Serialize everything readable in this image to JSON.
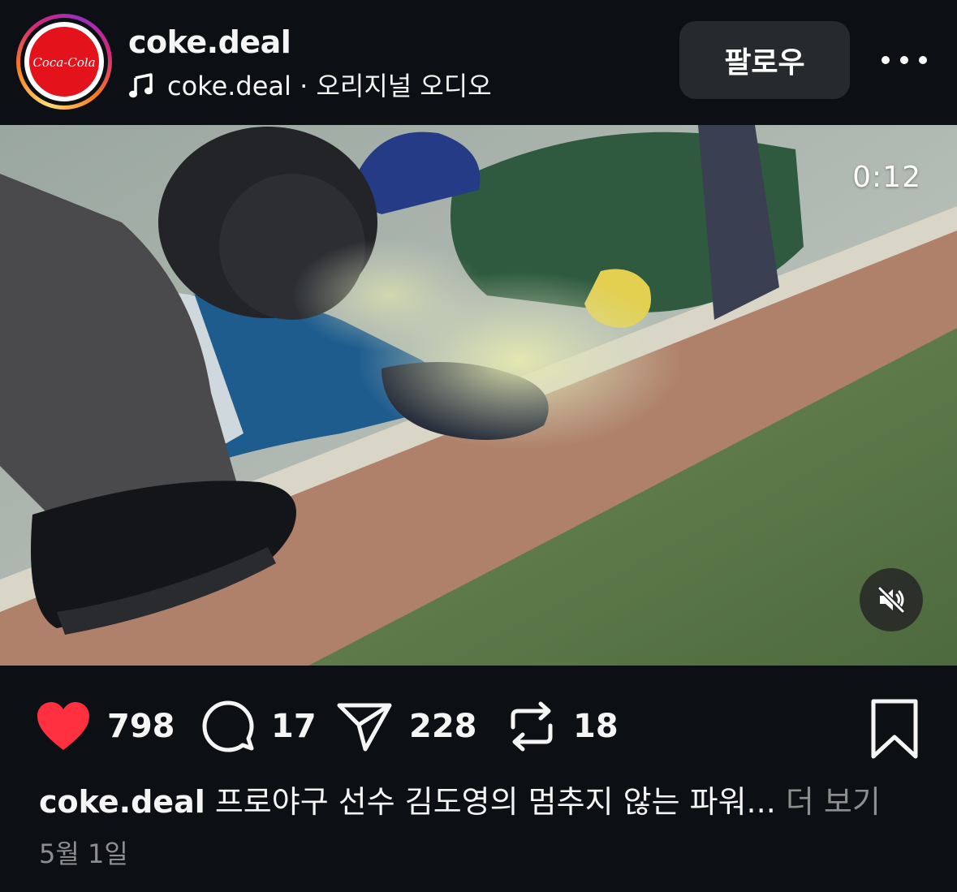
{
  "header": {
    "username": "coke.deal",
    "avatar_logo_text": "Coca-Cola",
    "audio_label": "coke.deal · 오리지널 오디오",
    "follow_label": "팔로우"
  },
  "video": {
    "timer": "0:12",
    "muted": true
  },
  "actions": {
    "likes": "798",
    "comments": "17",
    "shares": "228",
    "reposts": "18",
    "liked": true
  },
  "caption": {
    "username": "coke.deal",
    "text": "프로야구 선수 김도영의 멈추지 않는 파워...",
    "more_label": "더 보기"
  },
  "date": "5월 1일",
  "colors": {
    "background": "#0c1014",
    "like_red": "#ff3040",
    "button_bg": "#26292e",
    "muted_text": "#8e8e8e"
  }
}
